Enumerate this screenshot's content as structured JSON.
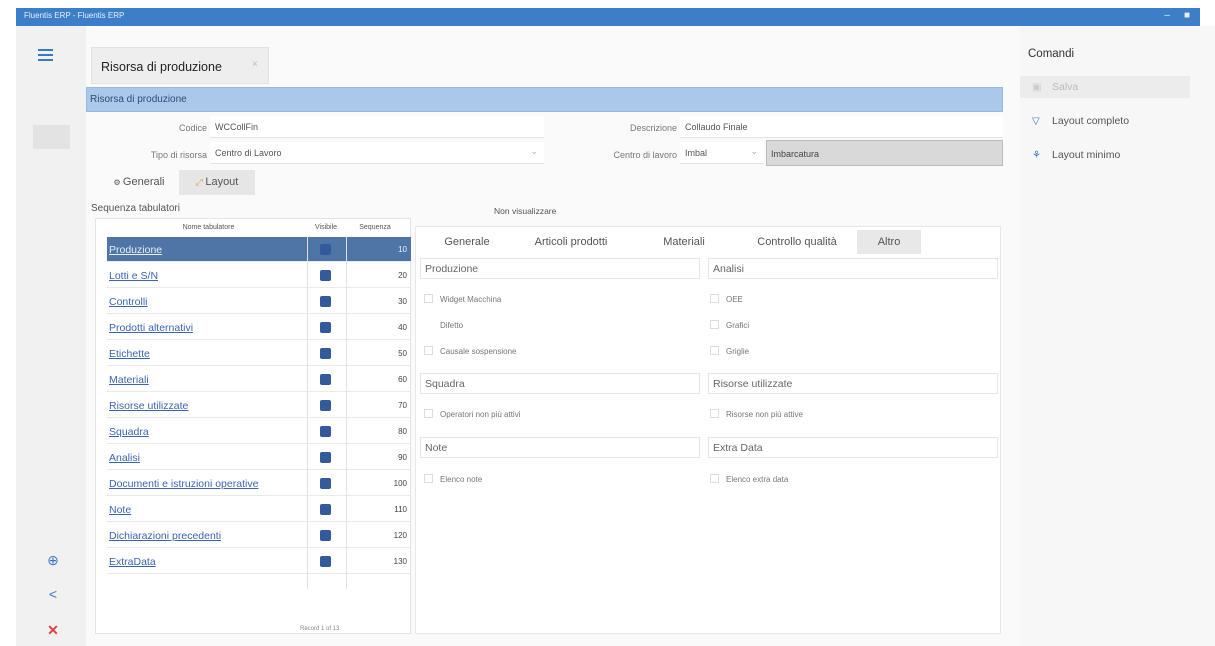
{
  "window": {
    "title": "Fluentis ERP - Fluentis ERP"
  },
  "document_tab": {
    "title": "Risorsa di produzione",
    "close": "×"
  },
  "section": {
    "title": "Risorsa di produzione"
  },
  "form": {
    "codice_label": "Codice",
    "codice_value": "WCCollFin",
    "tipo_label": "Tipo di risorsa",
    "tipo_value": "Centro di Lavoro",
    "descrizione_label": "Descrizione",
    "descrizione_value": "Collaudo Finale",
    "centro_label": "Centro di lavoro",
    "centro_value": "Imbal",
    "centro_desc": "Imbarcatura"
  },
  "subtabs": {
    "generali": "Generali",
    "layout": "Layout"
  },
  "sequence": {
    "title": "Sequenza tabulatori",
    "columns": {
      "name": "Nome tabulatore",
      "visible": "Visibile",
      "seq": "Sequenza"
    },
    "rows": [
      {
        "name": "Produzione",
        "seq": "10"
      },
      {
        "name": "Lotti e S/N",
        "seq": "20"
      },
      {
        "name": "Controlli",
        "seq": "30"
      },
      {
        "name": "Prodotti alternativi",
        "seq": "40"
      },
      {
        "name": "Etichette",
        "seq": "50"
      },
      {
        "name": "Materiali",
        "seq": "60"
      },
      {
        "name": "Risorse utilizzate",
        "seq": "70"
      },
      {
        "name": "Squadra",
        "seq": "80"
      },
      {
        "name": "Analisi",
        "seq": "90"
      },
      {
        "name": "Documenti e istruzioni operative",
        "seq": "100"
      },
      {
        "name": "Note",
        "seq": "110"
      },
      {
        "name": "Dichiarazioni precedenti",
        "seq": "120"
      },
      {
        "name": "ExtraData",
        "seq": "130"
      }
    ],
    "footer": "Record 1 of 13"
  },
  "non_visualizzare": {
    "title": "Non visualizzare",
    "tabs": [
      "Generale",
      "Articoli prodotti",
      "Materiali",
      "Controllo qualità",
      "Altro"
    ],
    "groups": {
      "produzione": {
        "title": "Produzione",
        "items": [
          "Widget Macchina",
          "Difetto",
          "Causale sospensione"
        ]
      },
      "analisi": {
        "title": "Analisi",
        "items": [
          "OEE",
          "Grafici",
          "Griglie"
        ]
      },
      "squadra": {
        "title": "Squadra",
        "items": [
          "Operatori non più attivi"
        ]
      },
      "risorse": {
        "title": "Risorse utilizzate",
        "items": [
          "Risorse non più attive"
        ]
      },
      "note": {
        "title": "Note",
        "items": [
          "Elenco note"
        ]
      },
      "extra": {
        "title": "Extra Data",
        "items": [
          "Elenco extra data"
        ]
      }
    }
  },
  "commands": {
    "title": "Comandi",
    "save": "Salva",
    "layout_full": "Layout completo",
    "layout_min": "Layout minimo"
  },
  "colors": {
    "accent": "#3a78c0",
    "section_header": "#a9c8ea",
    "selected_row": "#4e75a6",
    "close": "#e04040"
  }
}
